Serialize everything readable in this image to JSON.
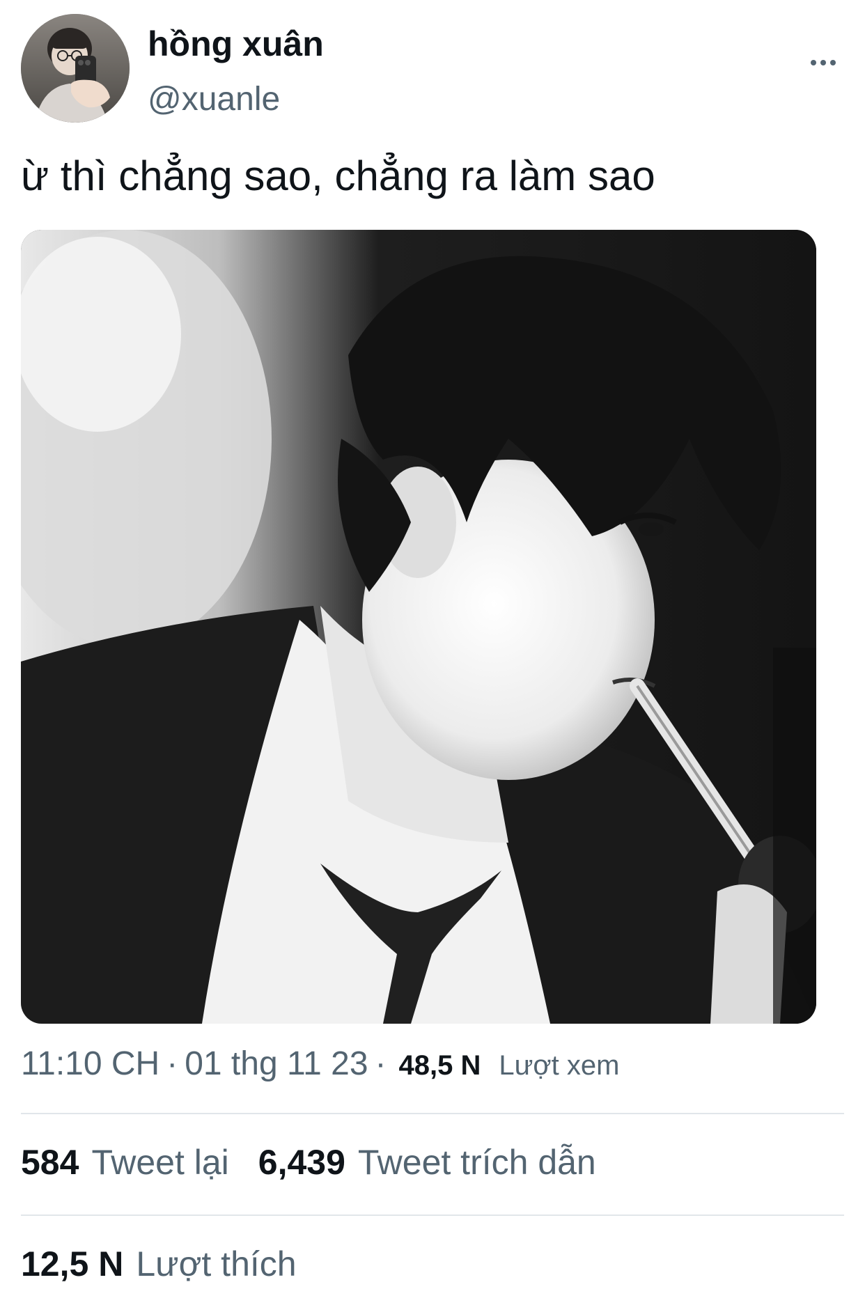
{
  "author": {
    "display_name": "hồng xuân",
    "handle": "@xuanle",
    "avatar_icon": "avatar-photo"
  },
  "more_icon": "more-horizontal-icon",
  "tweet": {
    "text": "ừ thì chẳng sao, chẳng ra làm sao",
    "media_description": "black-and-white photo"
  },
  "meta": {
    "time": "11:10 CH",
    "separator": "·",
    "date": "01 thg 11 23",
    "views_count": "48,5 N",
    "views_label": "Lượt xem"
  },
  "stats": {
    "retweets": {
      "count": "584",
      "label": "Tweet lại"
    },
    "quotes": {
      "count": "6,439",
      "label": "Tweet trích dẫn"
    },
    "likes": {
      "count": "12,5 N",
      "label": "Lượt thích"
    }
  },
  "colors": {
    "primary_text": "#0f1419",
    "secondary_text": "#536471",
    "divider": "#e1e6ea",
    "background": "#ffffff"
  }
}
